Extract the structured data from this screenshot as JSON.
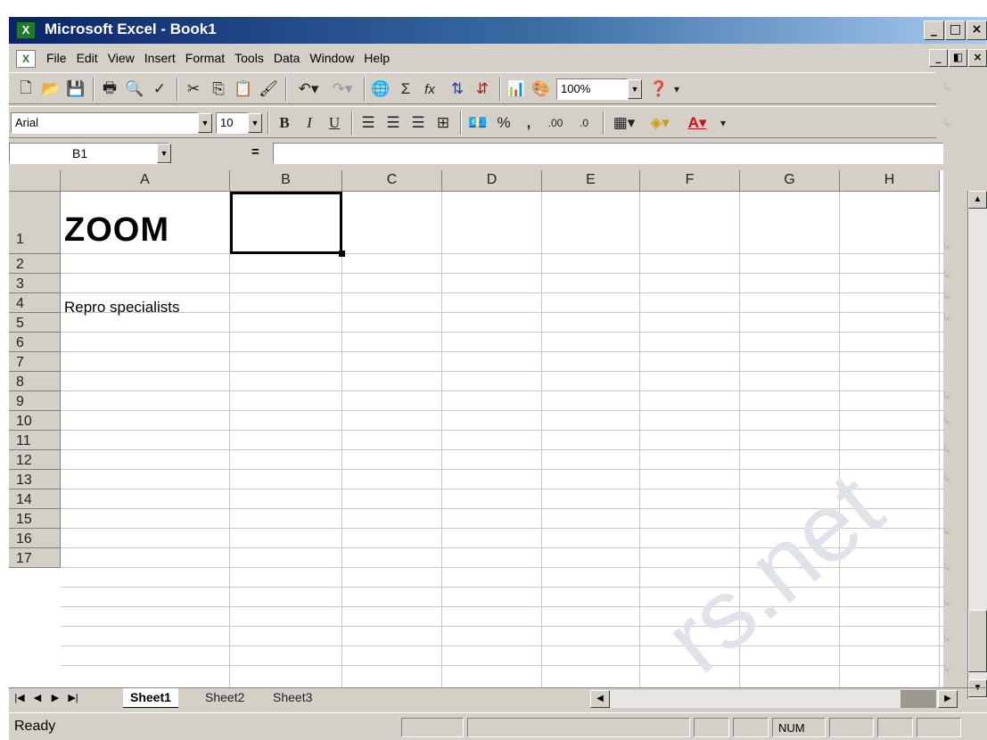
{
  "window": {
    "title": "Microsoft Excel - Book1",
    "app_icon_glyph": "X",
    "doc_icon_glyph": "X"
  },
  "caption_buttons": [
    "_",
    "□",
    "×"
  ],
  "doc_buttons": [
    "_",
    "◧",
    "×"
  ],
  "menu": [
    "File",
    "Edit",
    "View",
    "Insert",
    "Format",
    "Tools",
    "Data",
    "Window",
    "Help"
  ],
  "toolbar": {
    "zoom_value": "100%",
    "font_name": "Arial",
    "font_size": "10",
    "sigma": "Σ",
    "function": "fx",
    "bold": "B",
    "italic": "I",
    "underline": "U",
    "percent": "%",
    "comma": ",",
    "inc_decimal": ".00",
    "dec_decimal": ".0"
  },
  "formula_bar": {
    "name_box": "B1",
    "equals": "=",
    "content": ""
  },
  "columns": [
    "A",
    "B",
    "C",
    "D",
    "E",
    "F",
    "G",
    "H"
  ],
  "rows": [
    "1",
    "2",
    "3",
    "4",
    "5",
    "6",
    "7",
    "8",
    "9",
    "10",
    "11",
    "12",
    "13",
    "14",
    "15",
    "16",
    "17"
  ],
  "cells": {
    "A1": "ZOOM",
    "A2": "Repro specialists"
  },
  "sheet_tabs": [
    "Sheet1",
    "Sheet2",
    "Sheet3"
  ],
  "status": {
    "text": "Ready",
    "num_indicator": "NUM"
  },
  "watermark": "rs.net",
  "colors": {
    "title_start": "#0a246a",
    "title_end": "#a6caf0",
    "chrome": "#d4d0c8"
  }
}
